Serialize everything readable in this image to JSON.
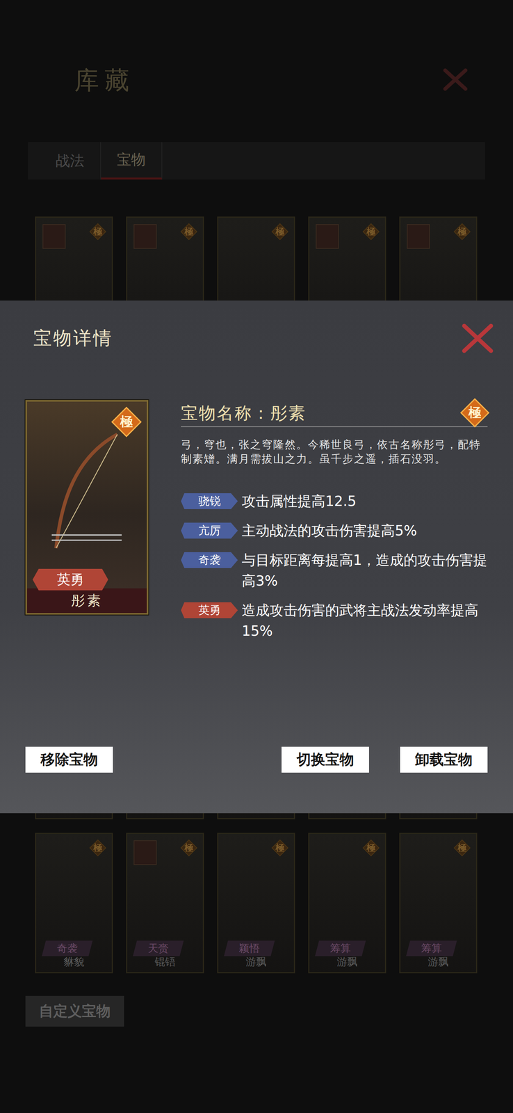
{
  "screen": {
    "title": "库藏",
    "tabs": [
      {
        "label": "战法",
        "selected": false
      },
      {
        "label": "宝物",
        "selected": true
      }
    ],
    "top_cards": [
      {
        "grade": "極",
        "hasPortrait": true
      },
      {
        "grade": "極",
        "hasPortrait": true
      },
      {
        "grade": "極",
        "hasPortrait": false
      },
      {
        "grade": "極",
        "hasPortrait": true
      },
      {
        "grade": "極",
        "hasPortrait": true
      }
    ],
    "bottom_cards": [
      {
        "grade": "極",
        "hasPortrait": false,
        "tag": "奇袭",
        "name": "貅貌"
      },
      {
        "grade": "極",
        "hasPortrait": true,
        "tag": "天赍",
        "name": "锟铻"
      },
      {
        "grade": "極",
        "hasPortrait": false,
        "tag": "颖悟",
        "name": "游飘"
      },
      {
        "grade": "極",
        "hasPortrait": false,
        "tag": "筹算",
        "name": "游飘"
      },
      {
        "grade": "極",
        "hasPortrait": false,
        "tag": "筹算",
        "name": "游飘"
      }
    ],
    "custom_button": "自定义宝物"
  },
  "modal": {
    "title": "宝物详情",
    "card": {
      "grade": "極",
      "tag": "英勇",
      "name": "彤素"
    },
    "name_line": "宝物名称：彤素",
    "grade": "極",
    "description": "弓，穹也，张之穹隆然。今稀世良弓，依古名称彤弓，配特制素矰。满月需拔山之力。虽千步之遥，插石没羽。",
    "effects": [
      {
        "tag": "骁锐",
        "text": "攻击属性提高12.5",
        "color": "#4b5f9e"
      },
      {
        "tag": "亢厉",
        "text": "主动战法的攻击伤害提高5%",
        "color": "#4b5f9e"
      },
      {
        "tag": "奇袭",
        "text": "与目标距离每提高1，造成的攻击伤害提高3%",
        "color": "#4b5f9e"
      },
      {
        "tag": "英勇",
        "text": "造成攻击伤害的武将主战法发动率提高15%",
        "color": "#b04536"
      }
    ],
    "buttons": [
      "移除宝物",
      "切换宝物",
      "卸载宝物"
    ]
  }
}
